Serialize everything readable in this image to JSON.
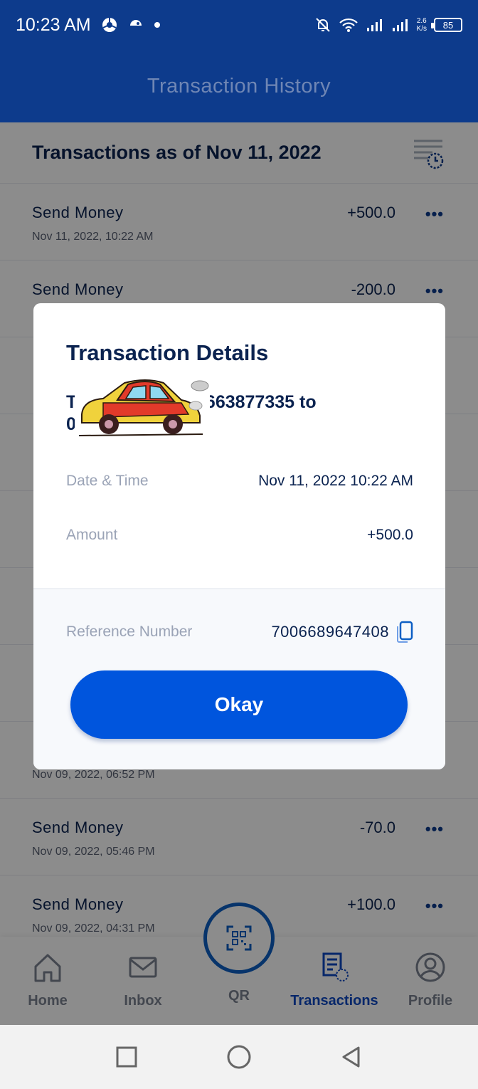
{
  "status_bar": {
    "time": "10:23 AM",
    "speed_top": "2.6",
    "speed_bottom": "K/s",
    "battery": "85"
  },
  "app_bar": {
    "title": "Transaction History"
  },
  "list": {
    "as_of": "Transactions as of Nov 11, 2022",
    "transactions": [
      {
        "name": "Send Money",
        "date": "Nov 11, 2022, 10:22 AM",
        "amount": "+500.0"
      },
      {
        "name": "Send Money",
        "date": "",
        "amount": "-200.0"
      },
      {
        "name": "",
        "date": "",
        "amount": ""
      },
      {
        "name": "",
        "date": "",
        "amount": ""
      },
      {
        "name": "",
        "date": "",
        "amount": ""
      },
      {
        "name": "",
        "date": "",
        "amount": ""
      },
      {
        "name": "",
        "date": "",
        "amount": ""
      },
      {
        "name": "",
        "date": "Nov 09, 2022, 06:52 PM",
        "amount": ""
      },
      {
        "name": "Send Money",
        "date": "Nov 09, 2022, 05:46 PM",
        "amount": "-70.0"
      },
      {
        "name": "Send Money",
        "date": "Nov 09, 2022, 04:31 PM",
        "amount": "+100.0"
      }
    ],
    "more_glyph": "•••"
  },
  "modal": {
    "title": "Transaction Details",
    "description": "Transfer from 09663877335 to 09364044933",
    "date_label": "Date & Time",
    "date_value": "Nov 11, 2022 10:22 AM",
    "amount_label": "Amount",
    "amount_value": "+500.0",
    "ref_label": "Reference Number",
    "ref_value": "7006689647408",
    "okay_label": "Okay"
  },
  "bottom_nav": {
    "home": "Home",
    "inbox": "Inbox",
    "qr": "QR",
    "transactions": "Transactions",
    "profile": "Profile"
  },
  "icons": {
    "home": "home-icon",
    "inbox": "mail-icon",
    "qr": "qr-scan-icon",
    "transactions": "receipt-clock-icon",
    "profile": "user-circle-icon",
    "filter": "filter-clock-icon",
    "copy": "copy-icon",
    "more": "more-icon"
  },
  "colors": {
    "primary": "#0d3b8c",
    "accent": "#0055dd",
    "text_dark": "#0b2350"
  }
}
